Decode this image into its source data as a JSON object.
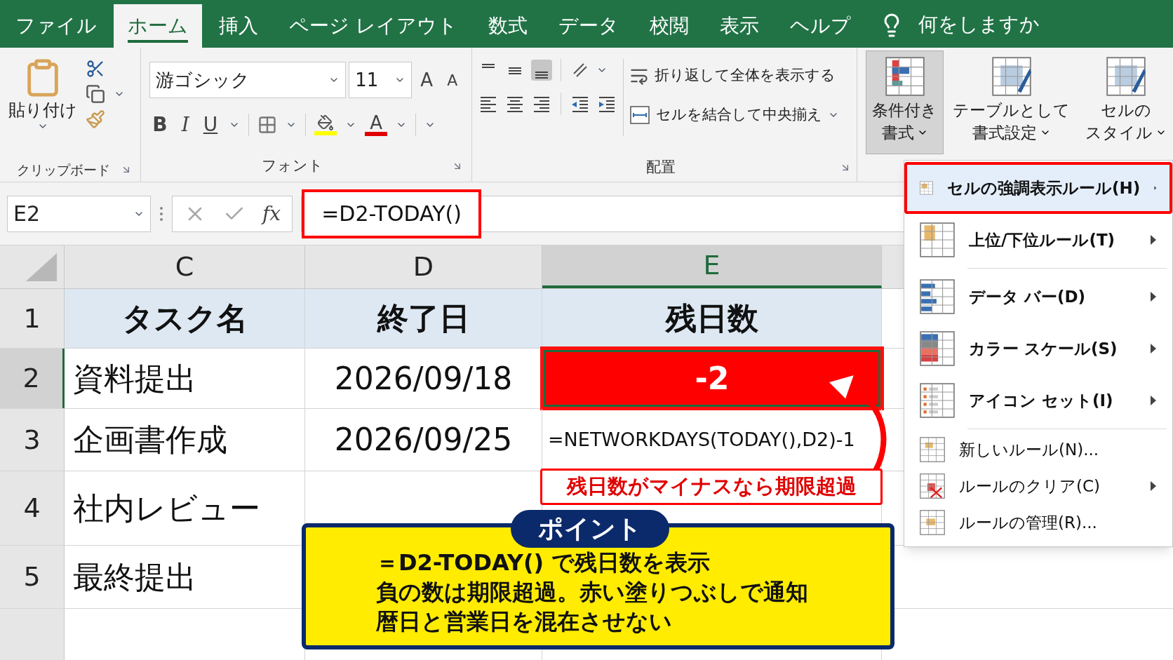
{
  "ribbon_tabs": [
    {
      "label": "ファイル",
      "selected": false
    },
    {
      "label": "ホーム",
      "selected": true
    },
    {
      "label": "挿入",
      "selected": false
    },
    {
      "label": "ページ レイアウト",
      "selected": false
    },
    {
      "label": "数式",
      "selected": false
    },
    {
      "label": "データ",
      "selected": false
    },
    {
      "label": "校閲",
      "selected": false
    },
    {
      "label": "表示",
      "selected": false
    },
    {
      "label": "ヘルプ",
      "selected": false
    }
  ],
  "tell_me": "何をしますか",
  "clipboard": {
    "paste": "貼り付け",
    "group": "クリップボード"
  },
  "font": {
    "name": "游ゴシック",
    "size": "11",
    "grow": "A",
    "shrink": "A",
    "bold": "B",
    "italic": "I",
    "underline": "U",
    "font_color": "A",
    "group": "フォント"
  },
  "alignment": {
    "wrap": "折り返して全体を表示する",
    "merge": "セルを結合して中央揃え",
    "group": "配置"
  },
  "styles": [
    {
      "lines": [
        "条件付き",
        "書式"
      ],
      "selected": true
    },
    {
      "lines": [
        "テーブルとして",
        "書式設定"
      ],
      "selected": false
    },
    {
      "lines": [
        "セルの",
        "スタイル"
      ],
      "selected": false
    }
  ],
  "formula_bar": {
    "name_box": "E2",
    "fx": "fx",
    "formula": "=D2-TODAY()"
  },
  "columns": [
    {
      "label": "C",
      "selected": false
    },
    {
      "label": "D",
      "selected": false
    },
    {
      "label": "E",
      "selected": true
    }
  ],
  "rows": [
    {
      "number": "1",
      "selected": false,
      "kind": "header",
      "cells": [
        {
          "text": "タスク名",
          "alert": false
        },
        {
          "text": "終了日",
          "alert": false
        },
        {
          "text": "残日数",
          "alert": false
        }
      ]
    },
    {
      "number": "2",
      "selected": true,
      "kind": "data",
      "cells": [
        {
          "text": "資料提出",
          "alert": false
        },
        {
          "text": "2026/09/18",
          "alert": false
        },
        {
          "text": "-2",
          "alert": true
        }
      ]
    },
    {
      "number": "3",
      "selected": false,
      "kind": "data",
      "cells": [
        {
          "text": "企画書作成",
          "alert": false
        },
        {
          "text": "2026/09/25",
          "alert": false
        },
        {
          "text": "=NETWORKDAYS(TODAY(),D2)-1",
          "alert": false,
          "kind": "formula"
        }
      ]
    },
    {
      "number": "4",
      "selected": false,
      "kind": "data",
      "cells": [
        {
          "text": "社内レビュー",
          "alert": false
        }
      ]
    },
    {
      "number": "5",
      "selected": false,
      "kind": "data",
      "cells": [
        {
          "text": "最終提出",
          "alert": false
        }
      ]
    }
  ],
  "menu": [
    {
      "label": "セルの強調表示ルール(H)",
      "kind": "major",
      "submenu": true,
      "selected": true,
      "separator_before": false
    },
    {
      "label": "上位/下位ルール(T)",
      "kind": "major",
      "submenu": true,
      "selected": false,
      "separator_before": false
    },
    {
      "label": "データ バー(D)",
      "kind": "major",
      "submenu": true,
      "selected": false,
      "separator_before": true
    },
    {
      "label": "カラー スケール(S)",
      "kind": "major",
      "submenu": true,
      "selected": false,
      "separator_before": false
    },
    {
      "label": "アイコン セット(I)",
      "kind": "major",
      "submenu": true,
      "selected": false,
      "separator_before": false
    },
    {
      "label": "新しいルール(N)...",
      "kind": "minor",
      "submenu": false,
      "selected": false,
      "separator_before": true
    },
    {
      "label": "ルールのクリア(C)",
      "kind": "minor",
      "submenu": true,
      "selected": false,
      "separator_before": false
    },
    {
      "label": "ルールの管理(R)...",
      "kind": "minor",
      "submenu": false,
      "selected": false,
      "separator_before": false
    }
  ],
  "callout": "残日数がマイナスなら期限超過",
  "point": {
    "title": "ポイント",
    "lines": [
      "＝D2-TODAY() で残日数を表示",
      "負の数は期限超過。赤い塗りつぶしで通知",
      "暦日と営業日を混在させない"
    ]
  }
}
